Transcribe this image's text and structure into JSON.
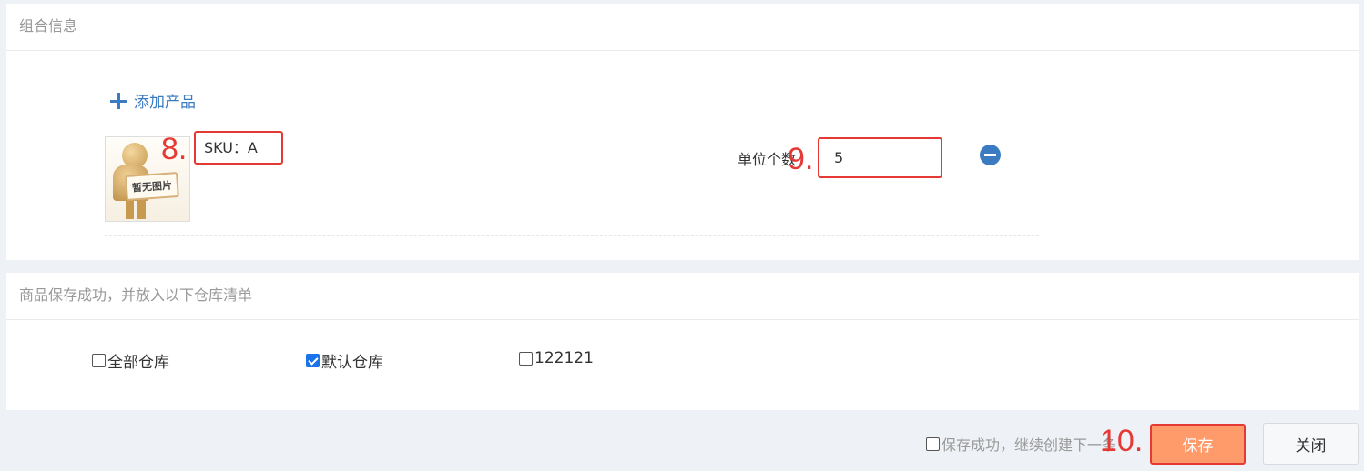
{
  "combo_panel": {
    "title": "组合信息",
    "add_product": "添加产品",
    "product": {
      "image_placeholder": "暂无图片",
      "sku": "SKU：A",
      "unit_label": "单位个数",
      "unit_count": "5"
    }
  },
  "warehouse_panel": {
    "title": "商品保存成功，并放入以下仓库清单",
    "warehouses": [
      {
        "label": "全部仓库",
        "checked": false
      },
      {
        "label": "默认仓库",
        "checked": true
      },
      {
        "label": "122121",
        "checked": false
      }
    ]
  },
  "footer": {
    "continue_label": "保存成功，继续创建下一条",
    "save_label": "保存",
    "close_label": "关闭"
  },
  "annotations": [
    "8.",
    "9.",
    "10."
  ],
  "colors": {
    "accent_blue": "#3b7bc2",
    "highlight_red": "#e53935",
    "save_orange": "#ff9a6a"
  }
}
